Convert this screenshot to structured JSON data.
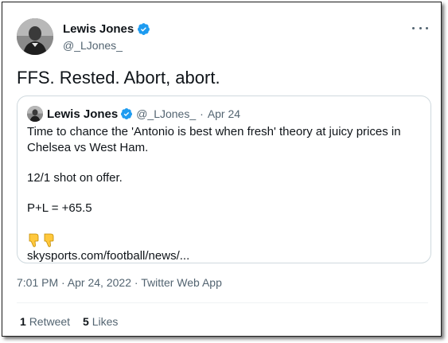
{
  "tweet": {
    "author_name": "Lewis Jones",
    "author_handle": "@_LJones_",
    "text": "FFS. Rested. Abort, abort.",
    "timestamp": "7:01 PM · Apr 24, 2022",
    "source": "Twitter Web App",
    "meta_separator": "·"
  },
  "quoted": {
    "author_name": "Lewis Jones",
    "author_handle": "@_LJones_",
    "separator": "·",
    "date": "Apr 24",
    "lines": [
      "Time to chance the 'Antonio is best when fresh' theory at juicy prices in Chelsea vs West Ham.",
      "12/1 shot on offer.",
      "P+L = +65.5"
    ],
    "emoji": [
      "thumbs-down",
      "thumbs-down"
    ],
    "link": "skysports.com/football/news/..."
  },
  "stats": {
    "retweets_count": "1",
    "retweets_label": "Retweet",
    "likes_count": "5",
    "likes_label": "Likes"
  },
  "colors": {
    "verified": "#1d9bf0",
    "secondary_text": "#536471",
    "emoji": "#ffc83d"
  },
  "icons": {
    "verified": "verified-badge-icon",
    "more": "more-icon"
  }
}
